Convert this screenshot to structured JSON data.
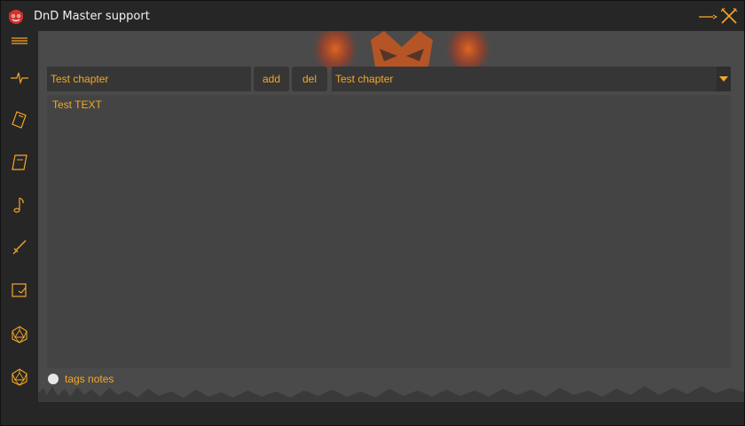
{
  "window": {
    "title": "DnD Master support",
    "accent_color": "#f5a623",
    "app_icon": "demon-mask-icon",
    "controls": [
      "minimize-icon",
      "close-icon"
    ]
  },
  "sidebar": {
    "items": [
      {
        "icon": "menu-icon"
      },
      {
        "icon": "pulse-icon"
      },
      {
        "icon": "notebook-icon"
      },
      {
        "icon": "scroll-icon"
      },
      {
        "icon": "music-note-icon"
      },
      {
        "icon": "sword-icon"
      },
      {
        "icon": "edit-box-icon"
      },
      {
        "icon": "d20-icon"
      },
      {
        "icon": "d20-icon"
      }
    ]
  },
  "editor": {
    "chapter_input_value": "Test chapter",
    "add_label": "add",
    "del_label": "del",
    "chapter_select_value": "Test chapter",
    "text_content": "Test TEXT",
    "radio_label": "tags notes"
  }
}
